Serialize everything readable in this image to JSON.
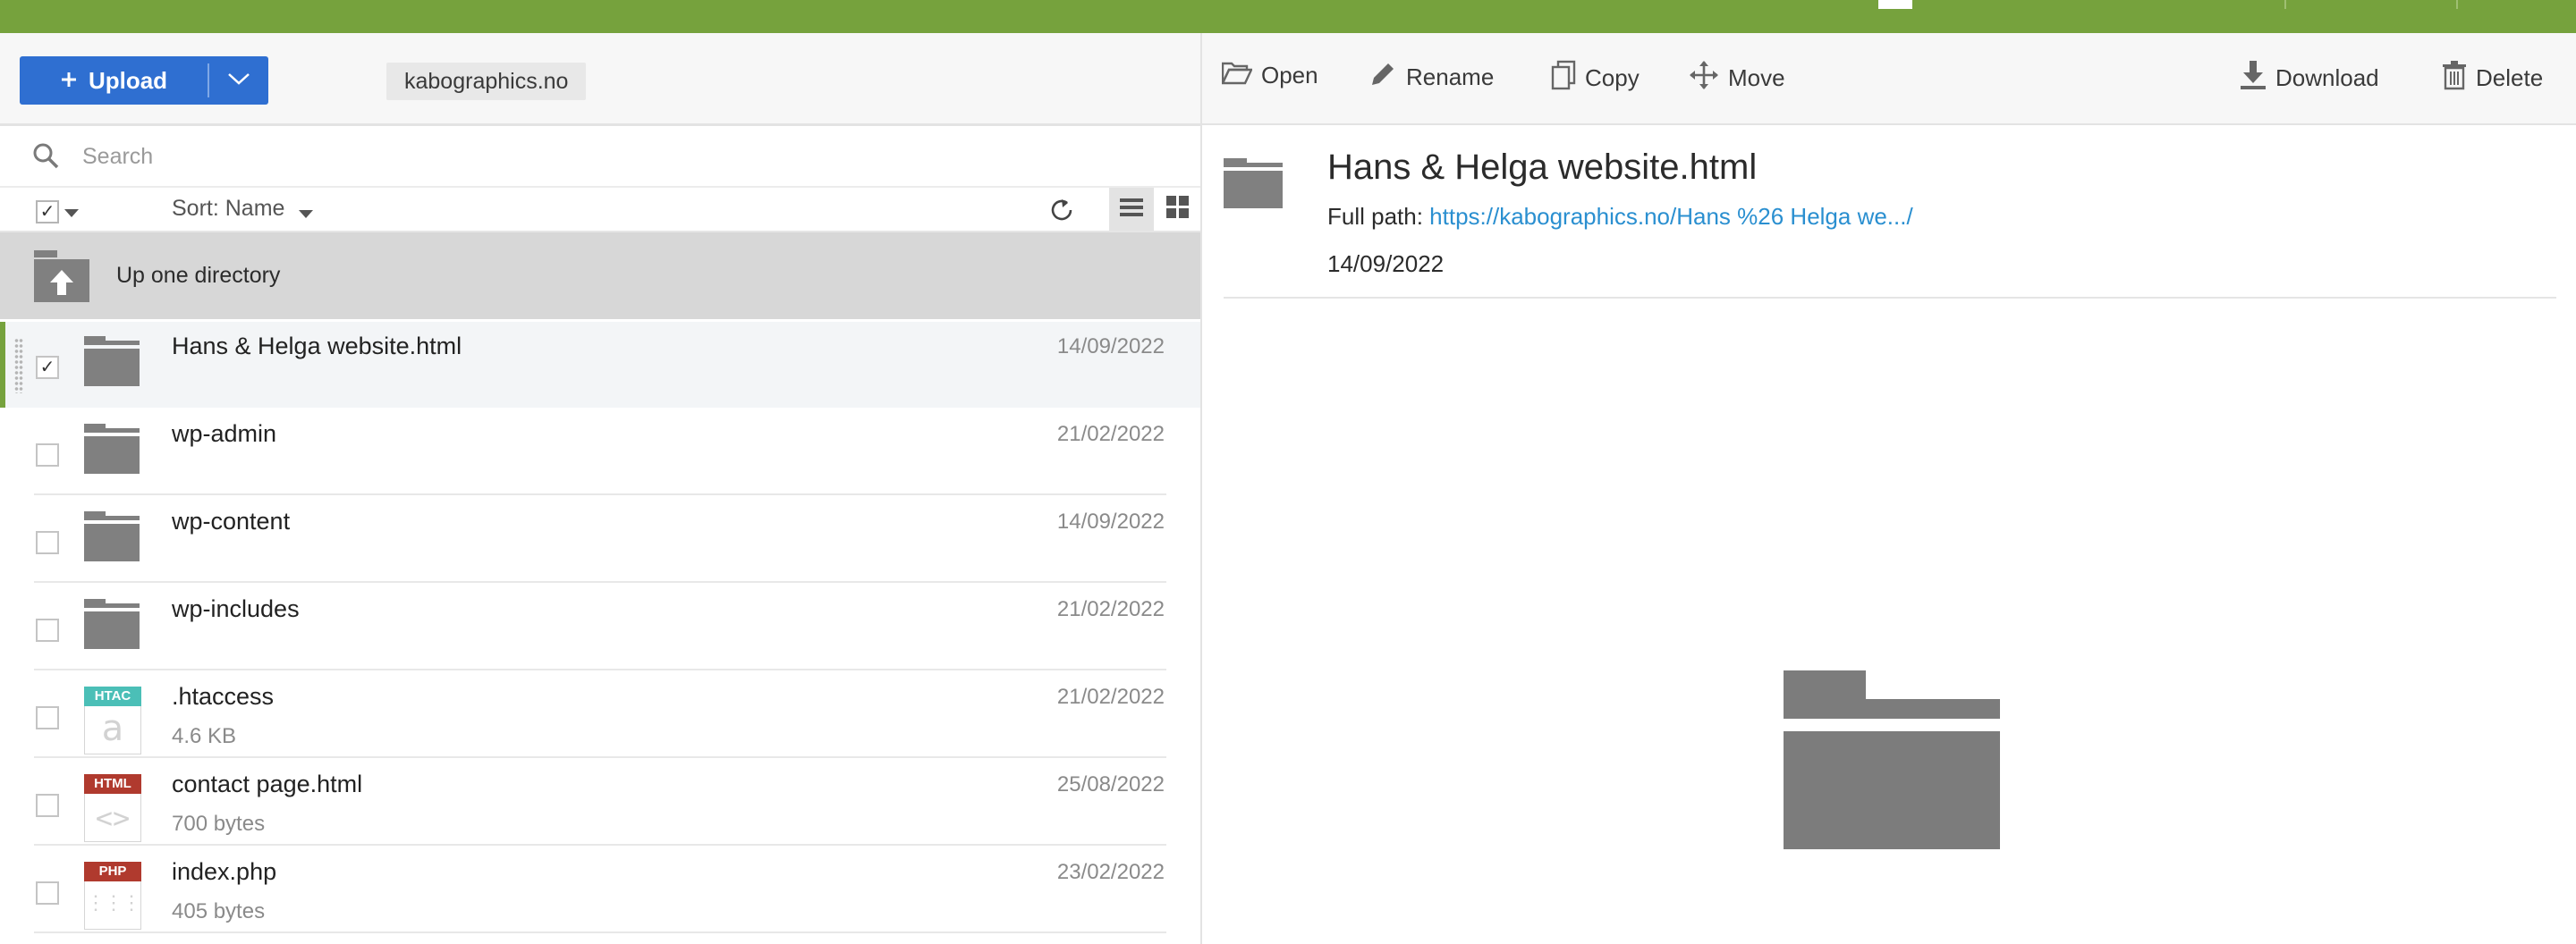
{
  "colors": {
    "accent_green": "#76a23d",
    "primary_blue": "#2f6fd1",
    "link": "#2a8fd0",
    "htac": "#4bbfb7",
    "html": "#b03a2e",
    "php": "#b03a2e"
  },
  "toolbar": {
    "upload_label": "Upload",
    "domain": "kabographics.no"
  },
  "search": {
    "placeholder": "Search"
  },
  "list_header": {
    "sort_label": "Sort: Name"
  },
  "up_directory": {
    "label": "Up one directory"
  },
  "files": [
    {
      "name": "Hans & Helga website.html",
      "date": "14/09/2022",
      "type": "folder",
      "checked": true,
      "selected": true
    },
    {
      "name": "wp-admin",
      "date": "21/02/2022",
      "type": "folder"
    },
    {
      "name": "wp-content",
      "date": "14/09/2022",
      "type": "folder"
    },
    {
      "name": "wp-includes",
      "date": "21/02/2022",
      "type": "folder"
    },
    {
      "name": ".htaccess",
      "date": "21/02/2022",
      "size": "4.6 KB",
      "type": "file",
      "badge": "HTAC",
      "glyph": "a"
    },
    {
      "name": "contact page.html",
      "date": "25/08/2022",
      "size": "700 bytes",
      "type": "file",
      "badge": "HTML",
      "glyph": "<>"
    },
    {
      "name": "index.php",
      "date": "23/02/2022",
      "size": "405 bytes",
      "type": "file",
      "badge": "PHP",
      "glyph": "⋮⋮⋮"
    }
  ],
  "actions": {
    "open": "Open",
    "rename": "Rename",
    "copy": "Copy",
    "move": "Move",
    "download": "Download",
    "delete": "Delete"
  },
  "details": {
    "title": "Hans & Helga website.html",
    "path_label": "Full path: ",
    "path_link": "https://kabographics.no/Hans %26 Helga we.../",
    "date": "14/09/2022"
  }
}
